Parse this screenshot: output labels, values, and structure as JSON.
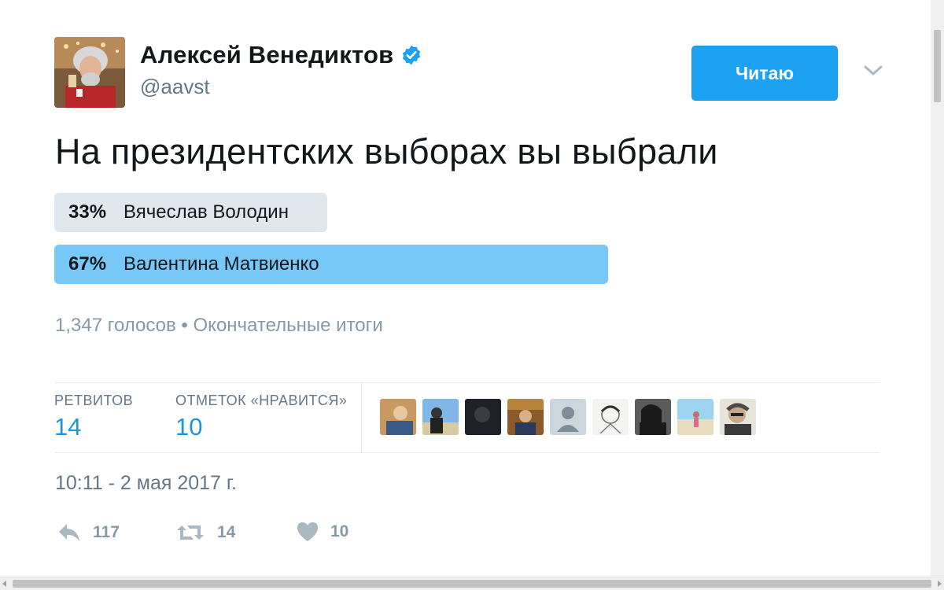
{
  "author": {
    "name": "Алексей Венедиктов",
    "handle": "@aavst",
    "verified": true,
    "verified_icon": "verified-badge-icon",
    "accent_color": "#1da1f2"
  },
  "follow_button": {
    "label": "Читаю"
  },
  "menu": {
    "icon": "chevron-down-icon"
  },
  "tweet": {
    "text": "На президентских выборах вы выбрали"
  },
  "poll": {
    "choices": [
      {
        "percent": "33%",
        "label": "Вячеслав Володин",
        "fraction": 0.33,
        "color": "#e1e8ed"
      },
      {
        "percent": "67%",
        "label": "Валентина Матвиенко",
        "fraction": 0.67,
        "color": "#77c7f7"
      }
    ],
    "meta": "1,347 голосов • Окончательные итоги"
  },
  "stats": {
    "retweets_label": "РЕТВИТОВ",
    "retweets_value": "14",
    "likes_label": "ОТМЕТОК «НРАВИТСЯ»",
    "likes_value": "10"
  },
  "likers": [
    "liker-avatar-1",
    "liker-avatar-2",
    "liker-avatar-3",
    "liker-avatar-4",
    "liker-avatar-5",
    "liker-avatar-6",
    "liker-avatar-7",
    "liker-avatar-8",
    "liker-avatar-9"
  ],
  "timestamp": "10:11 - 2 мая 2017 г.",
  "actions": {
    "reply_count": "117",
    "retweet_count": "14",
    "like_count": "10",
    "reply_icon": "reply-icon",
    "retweet_icon": "retweet-icon",
    "like_icon": "heart-icon"
  }
}
